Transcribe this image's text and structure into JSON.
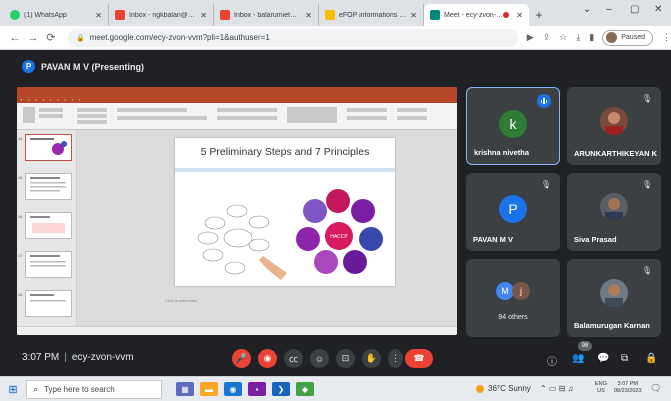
{
  "browser": {
    "tabs": [
      {
        "title": "(1) WhatsApp",
        "favicon_color": "#25d366"
      },
      {
        "title": "Inbox - ngkbalan@gmail",
        "favicon_color": "#ea4335"
      },
      {
        "title": "Inbox - balarumiet@gm",
        "favicon_color": "#ea4335"
      },
      {
        "title": "eFOP informations - Goo",
        "favicon_color": "#fbbc04"
      },
      {
        "title": "Meet - ecy-zvon-vvm",
        "favicon_color": "#00897b"
      }
    ],
    "url": "meet.google.com/ecy-zvon-vvm?pli=1&authuser=1",
    "profile_label": "Paused"
  },
  "meet": {
    "presenter_initial": "P",
    "presenter_label": "PAVAN M V (Presenting)",
    "meeting_time": "3:07 PM",
    "meeting_code": "ecy-zvon-vvm",
    "participant_count": "98"
  },
  "slide": {
    "title": "5 Preliminary Steps and 7 Principles",
    "notes_placeholder": "Click to add notes",
    "center_label": "HACCP",
    "colors": {
      "accent": "#b7472a"
    }
  },
  "participants": [
    {
      "name": "krishna nivetha",
      "initial": "k",
      "color": "#2e7d32",
      "speaking": true
    },
    {
      "name": "ARUNKARTHIKEYAN K",
      "type": "photo"
    },
    {
      "name": "PAVAN M V",
      "initial": "P",
      "color": "#1a73e8"
    },
    {
      "name": "Siva Prasad",
      "type": "photo"
    },
    {
      "others": "94 others",
      "initials": [
        "M",
        "j"
      ]
    },
    {
      "name": "Balamurugan Karnan",
      "type": "photo"
    }
  ],
  "taskbar": {
    "search_placeholder": "Type here to search",
    "weather": "36°C  Sunny",
    "lang_top": "ENG",
    "lang_bottom": "US",
    "time": "3:07 PM",
    "date": "08/23/2023"
  }
}
